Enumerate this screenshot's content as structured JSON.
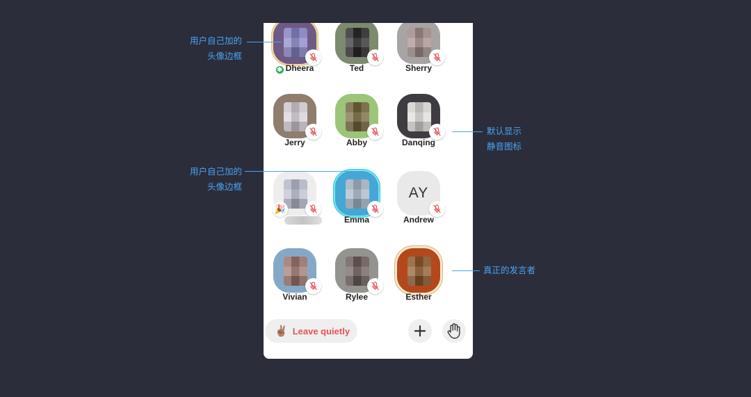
{
  "participants": [
    {
      "name": "Dheera",
      "moderator": true,
      "muted": true,
      "bg": "#6f5a86",
      "px": "#8a86c8",
      "frame": "frame"
    },
    {
      "name": "Ted",
      "muted": true,
      "bg": "#7c8a6e",
      "px": "#2c2a2a"
    },
    {
      "name": "Sherry",
      "muted": true,
      "bg": "#a7a4a3",
      "px": "#a58f8c"
    },
    {
      "name": "Jerry",
      "muted": true,
      "bg": "#8f7d6e",
      "px": "#d7d1d9"
    },
    {
      "name": "Abby",
      "muted": true,
      "bg": "#9cc57a",
      "px": "#75683d"
    },
    {
      "name": "Danqing",
      "muted": true,
      "bg": "#3e3c41",
      "px": "#e0dcdc"
    },
    {
      "name": "",
      "muted": true,
      "bg": "#ededed",
      "px": "#bcc0d0",
      "emoji": "🎉",
      "blurred_name": true
    },
    {
      "name": "Emma",
      "muted": true,
      "bg": "#44a7d6",
      "px": "#a9b9c9",
      "frame": "frame-blue"
    },
    {
      "name": "Andrew",
      "muted": true,
      "bg": "#e9e9e9",
      "initials": "AY"
    },
    {
      "name": "Vivian",
      "muted": true,
      "bg": "#86a8c7",
      "px": "#a0786e"
    },
    {
      "name": "Rylee",
      "muted": true,
      "bg": "#93938f",
      "px": "#6e5f5c"
    },
    {
      "name": "Esther",
      "muted": false,
      "bg": "#b4481c",
      "px": "#8e5a2c",
      "frame": "frame-gold"
    }
  ],
  "bottom_bar": {
    "leave_emoji": "✌🏽",
    "leave_label": "Leave quietly",
    "add_icon": "plus-icon",
    "raise_hand_icon": "raise-hand-icon"
  },
  "annotations": {
    "custom_frame_1": [
      "用户自己加的",
      "头像边框"
    ],
    "custom_frame_2": [
      "用户自己加的",
      "头像边框"
    ],
    "default_mute": [
      "默认显示",
      "静音图标"
    ],
    "real_speaker": [
      "真正的发言者"
    ]
  },
  "colors": {
    "background": "#2b2d3a",
    "annotation": "#4aa3f0",
    "leave_text": "#e5535a",
    "mute_icon": "#e5535a",
    "moderator_badge": "#27ae60"
  }
}
